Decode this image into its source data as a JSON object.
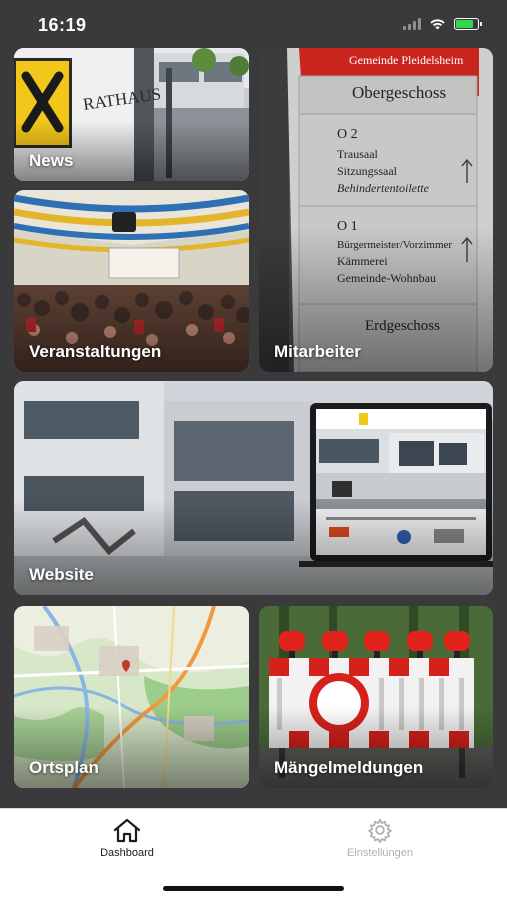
{
  "status": {
    "time": "16:19",
    "battery_color": "#32d74b"
  },
  "tiles": {
    "news": "News",
    "mitarbeiter": "Mitarbeiter",
    "veranstaltungen": "Veranstaltungen",
    "website": "Website",
    "ortsplan": "Ortsplan",
    "maengel": "Mängelmeldungen"
  },
  "photos": {
    "rathaus_sign": "RATHAUS",
    "directory_header": "Gemeinde Pleidelsheim",
    "directory_floor_upper": "Obergeschoss",
    "directory_o2": "O 2",
    "directory_o2_rooms": [
      "Trausaal",
      "Sitzungssaal",
      "Behindertentoilette"
    ],
    "directory_o1": "O 1",
    "directory_o1_rooms": [
      "Bürgermeister/Vorzimmer",
      "Kämmerei",
      "Gemeinde-Wohnbau"
    ],
    "directory_floor_ground": "Erdgeschoss"
  },
  "tabbar": {
    "dashboard": "Dashboard",
    "einstellungen": "Einstellungen",
    "active_color": "#1c1c1e",
    "inactive_color": "#b0b0b0"
  }
}
